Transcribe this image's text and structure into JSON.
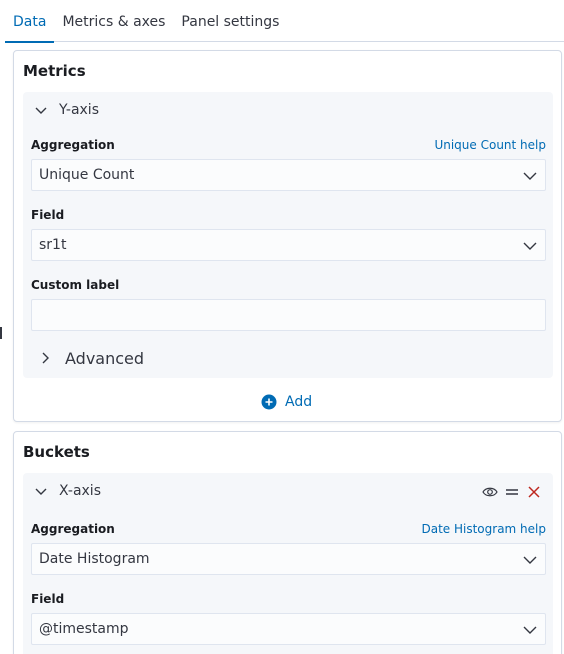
{
  "tabs": [
    {
      "label": "Data",
      "active": true
    },
    {
      "label": "Metrics & axes",
      "active": false
    },
    {
      "label": "Panel settings",
      "active": false
    }
  ],
  "metrics": {
    "title": "Metrics",
    "yaxis": {
      "header": "Y-axis",
      "aggregation_label": "Aggregation",
      "aggregation_help": "Unique Count help",
      "aggregation_value": "Unique Count",
      "field_label": "Field",
      "field_value": "sr1t",
      "custom_label_label": "Custom label",
      "custom_label_value": "",
      "advanced": "Advanced"
    },
    "add": "Add"
  },
  "buckets": {
    "title": "Buckets",
    "xaxis": {
      "header": "X-axis",
      "aggregation_label": "Aggregation",
      "aggregation_help": "Date Histogram help",
      "aggregation_value": "Date Histogram",
      "field_label": "Field",
      "field_value": "@timestamp"
    }
  },
  "colors": {
    "accent": "#006bb4",
    "danger": "#bd271e",
    "border": "#d3dae6"
  }
}
